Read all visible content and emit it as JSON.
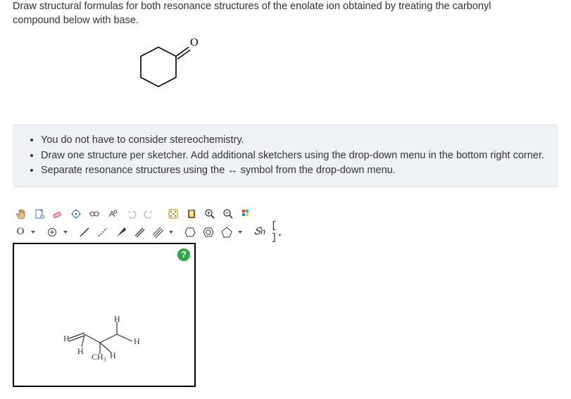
{
  "question": {
    "line1": "Draw structural formulas for both resonance structures of the enolate ion obtained by treating the carbonyl",
    "line2": "compound below with base."
  },
  "instructions": {
    "items": [
      "You do not have to consider stereochemistry.",
      "Draw one structure per sketcher. Add additional sketchers using the drop-down menu in the bottom right corner.",
      "Separate resonance structures using the ↔ symbol from the drop-down menu."
    ]
  },
  "toolbar": {
    "row1": {
      "hand": "hand-icon",
      "undo_stack": "document-icon",
      "eraser": "eraser-icon",
      "snap": "snap-icon",
      "glasses": "glasses-icon",
      "chemdraw": "structure-icon",
      "undo": "undo-icon",
      "redo": "redo-icon",
      "spin": "dice-icon",
      "paste": "paste-icon",
      "zoom_in": "zoom-in-icon",
      "zoom_out": "zoom-out-icon",
      "color": "color-icon"
    },
    "row2": {
      "atom": "O",
      "charge": "⊕",
      "bond1": "single-bond",
      "bond2": "recessed-bond",
      "bond3": "wedge-bond",
      "bond4": "double-bond",
      "bond5": "triple-bond",
      "ring1": "cyclohexane",
      "ring2": "benzene",
      "ring3": "cyclopentane",
      "chain": "𝑆n",
      "bracket": "[ ]⁺"
    },
    "help": "?"
  },
  "canvas": {
    "labels": {
      "H_top": "H",
      "H_left": "H",
      "H_right": "H",
      "H_bl": "H",
      "H_mid": "H",
      "CH3": "CH₃"
    }
  },
  "prompt_molecule": {
    "O_label": "O"
  }
}
